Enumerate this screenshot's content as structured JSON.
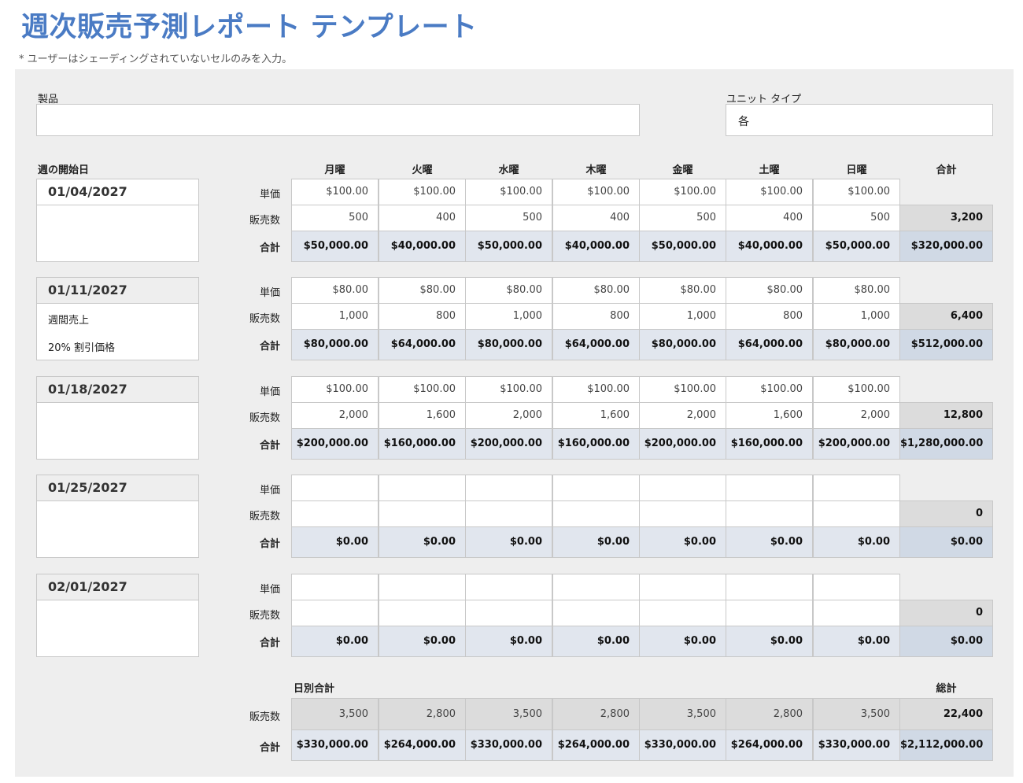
{
  "title": "週次販売予測レポート テンプレート",
  "note": "* ユーザーはシェーディングされていないセルのみを入力。",
  "product": {
    "label": "製品",
    "value": ""
  },
  "unit_type": {
    "label": "ユニット タイプ",
    "value": "各"
  },
  "headers": {
    "week_start": "週の開始日",
    "days": [
      "月曜",
      "火曜",
      "水曜",
      "木曜",
      "金曜",
      "土曜",
      "日曜"
    ],
    "total": "合計"
  },
  "row_labels": {
    "unit_price": "単価",
    "quantity": "販売数",
    "total": "合計"
  },
  "weeks": [
    {
      "date": "01/04/2027",
      "notes": [],
      "prices": [
        "$100.00",
        "$100.00",
        "$100.00",
        "$100.00",
        "$100.00",
        "$100.00",
        "$100.00"
      ],
      "quantities": [
        "500",
        "400",
        "500",
        "400",
        "500",
        "400",
        "500"
      ],
      "totals": [
        "$50,000.00",
        "$40,000.00",
        "$50,000.00",
        "$40,000.00",
        "$50,000.00",
        "$40,000.00",
        "$50,000.00"
      ],
      "quantity_sum": "3,200",
      "total_sum": "$320,000.00"
    },
    {
      "date": "01/11/2027",
      "notes": [
        "週間売上",
        "20% 割引価格"
      ],
      "prices": [
        "$80.00",
        "$80.00",
        "$80.00",
        "$80.00",
        "$80.00",
        "$80.00",
        "$80.00"
      ],
      "quantities": [
        "1,000",
        "800",
        "1,000",
        "800",
        "1,000",
        "800",
        "1,000"
      ],
      "totals": [
        "$80,000.00",
        "$64,000.00",
        "$80,000.00",
        "$64,000.00",
        "$80,000.00",
        "$64,000.00",
        "$80,000.00"
      ],
      "quantity_sum": "6,400",
      "total_sum": "$512,000.00"
    },
    {
      "date": "01/18/2027",
      "notes": [],
      "prices": [
        "$100.00",
        "$100.00",
        "$100.00",
        "$100.00",
        "$100.00",
        "$100.00",
        "$100.00"
      ],
      "quantities": [
        "2,000",
        "1,600",
        "2,000",
        "1,600",
        "2,000",
        "1,600",
        "2,000"
      ],
      "totals": [
        "$200,000.00",
        "$160,000.00",
        "$200,000.00",
        "$160,000.00",
        "$200,000.00",
        "$160,000.00",
        "$200,000.00"
      ],
      "quantity_sum": "12,800",
      "total_sum": "$1,280,000.00"
    },
    {
      "date": "01/25/2027",
      "notes": [],
      "prices": [
        "",
        "",
        "",
        "",
        "",
        "",
        ""
      ],
      "quantities": [
        "",
        "",
        "",
        "",
        "",
        "",
        ""
      ],
      "totals": [
        "$0.00",
        "$0.00",
        "$0.00",
        "$0.00",
        "$0.00",
        "$0.00",
        "$0.00"
      ],
      "quantity_sum": "0",
      "total_sum": "$0.00"
    },
    {
      "date": "02/01/2027",
      "notes": [],
      "prices": [
        "",
        "",
        "",
        "",
        "",
        "",
        ""
      ],
      "quantities": [
        "",
        "",
        "",
        "",
        "",
        "",
        ""
      ],
      "totals": [
        "$0.00",
        "$0.00",
        "$0.00",
        "$0.00",
        "$0.00",
        "$0.00",
        "$0.00"
      ],
      "quantity_sum": "0",
      "total_sum": "$0.00"
    }
  ],
  "daily": {
    "label": "日別合計",
    "grand_label": "総計",
    "quantities": [
      "3,500",
      "2,800",
      "3,500",
      "2,800",
      "3,500",
      "2,800",
      "3,500"
    ],
    "totals": [
      "$330,000.00",
      "$264,000.00",
      "$330,000.00",
      "$264,000.00",
      "$330,000.00",
      "$264,000.00",
      "$330,000.00"
    ],
    "quantity_sum": "22,400",
    "total_sum": "$2,112,000.00"
  },
  "colors": {
    "title": "#4a7bc4",
    "panel": "#eeeeee",
    "total_cell": "#e1e6ee",
    "count_cell": "#dcdcdc",
    "grand_cell": "#d0d9e5"
  }
}
